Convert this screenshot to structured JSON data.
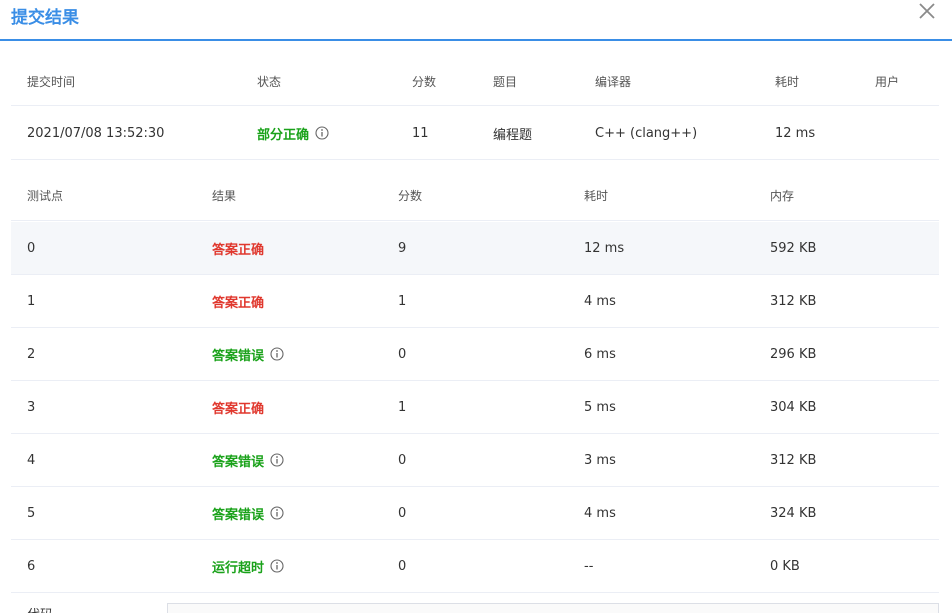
{
  "dialog": {
    "title": "提交结果"
  },
  "summary": {
    "headers": {
      "time": "提交时间",
      "status": "状态",
      "score": "分数",
      "problem": "题目",
      "compiler": "编译器",
      "time_cost": "耗时",
      "user": "用户"
    },
    "row": {
      "time": "2021/07/08 13:52:30",
      "status": "部分正确",
      "score": "11",
      "problem": "编程题",
      "compiler": "C++ (clang++)",
      "time_cost": "12 ms",
      "user": ""
    }
  },
  "tests": {
    "headers": {
      "case": "测试点",
      "result": "结果",
      "score": "分数",
      "time_cost": "耗时",
      "memory": "内存"
    },
    "rows": [
      {
        "case": "0",
        "result": "答案正确",
        "score": "9",
        "time_cost": "12 ms",
        "memory": "592 KB"
      },
      {
        "case": "1",
        "result": "答案正确",
        "score": "1",
        "time_cost": "4 ms",
        "memory": "312 KB"
      },
      {
        "case": "2",
        "result": "答案错误",
        "score": "0",
        "time_cost": "6 ms",
        "memory": "296 KB"
      },
      {
        "case": "3",
        "result": "答案正确",
        "score": "1",
        "time_cost": "5 ms",
        "memory": "304 KB"
      },
      {
        "case": "4",
        "result": "答案错误",
        "score": "0",
        "time_cost": "3 ms",
        "memory": "312 KB"
      },
      {
        "case": "5",
        "result": "答案错误",
        "score": "0",
        "time_cost": "4 ms",
        "memory": "324 KB"
      },
      {
        "case": "6",
        "result": "运行超时",
        "score": "0",
        "time_cost": "--",
        "memory": "0 KB"
      }
    ]
  },
  "code": {
    "label": "代码"
  },
  "colors": {
    "accent": "#3a8ee6",
    "correct": "#e0382e",
    "wrong": "#1aa21a"
  },
  "icons": {
    "close": "close-icon",
    "info": "info-icon"
  }
}
